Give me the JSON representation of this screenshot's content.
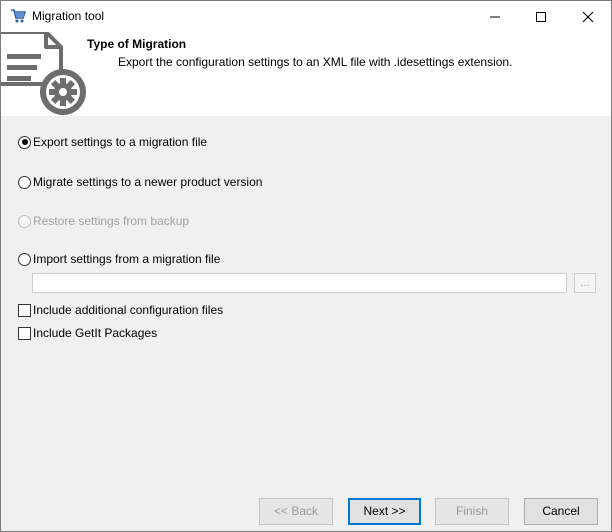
{
  "window": {
    "title": "Migration tool",
    "icon": "shopping-cart-icon"
  },
  "header": {
    "title": "Type of Migration",
    "description": "Export the configuration settings to an XML file with .idesettings extension.",
    "graphic": "document-gear-icon"
  },
  "options": {
    "export_label": "Export settings to a migration file",
    "export_selected": true,
    "migrate_label": "Migrate settings to a newer product version",
    "restore_label": "Restore settings from backup",
    "restore_enabled": false,
    "import_label": "Import settings from a migration file",
    "import_path_value": "",
    "browse_label": "...",
    "include_config_label": "Include additional configuration files",
    "include_config_checked": false,
    "include_getit_label": "Include GetIt Packages",
    "include_getit_checked": false
  },
  "buttons": {
    "back_label": "<< Back",
    "next_label": "Next >>",
    "finish_label": "Finish",
    "cancel_label": "Cancel"
  },
  "colors": {
    "focus_border": "#0078d7",
    "dialog_background": "#f0f0f0",
    "header_background": "#ffffff",
    "disabled_text": "#a0a0a0"
  }
}
